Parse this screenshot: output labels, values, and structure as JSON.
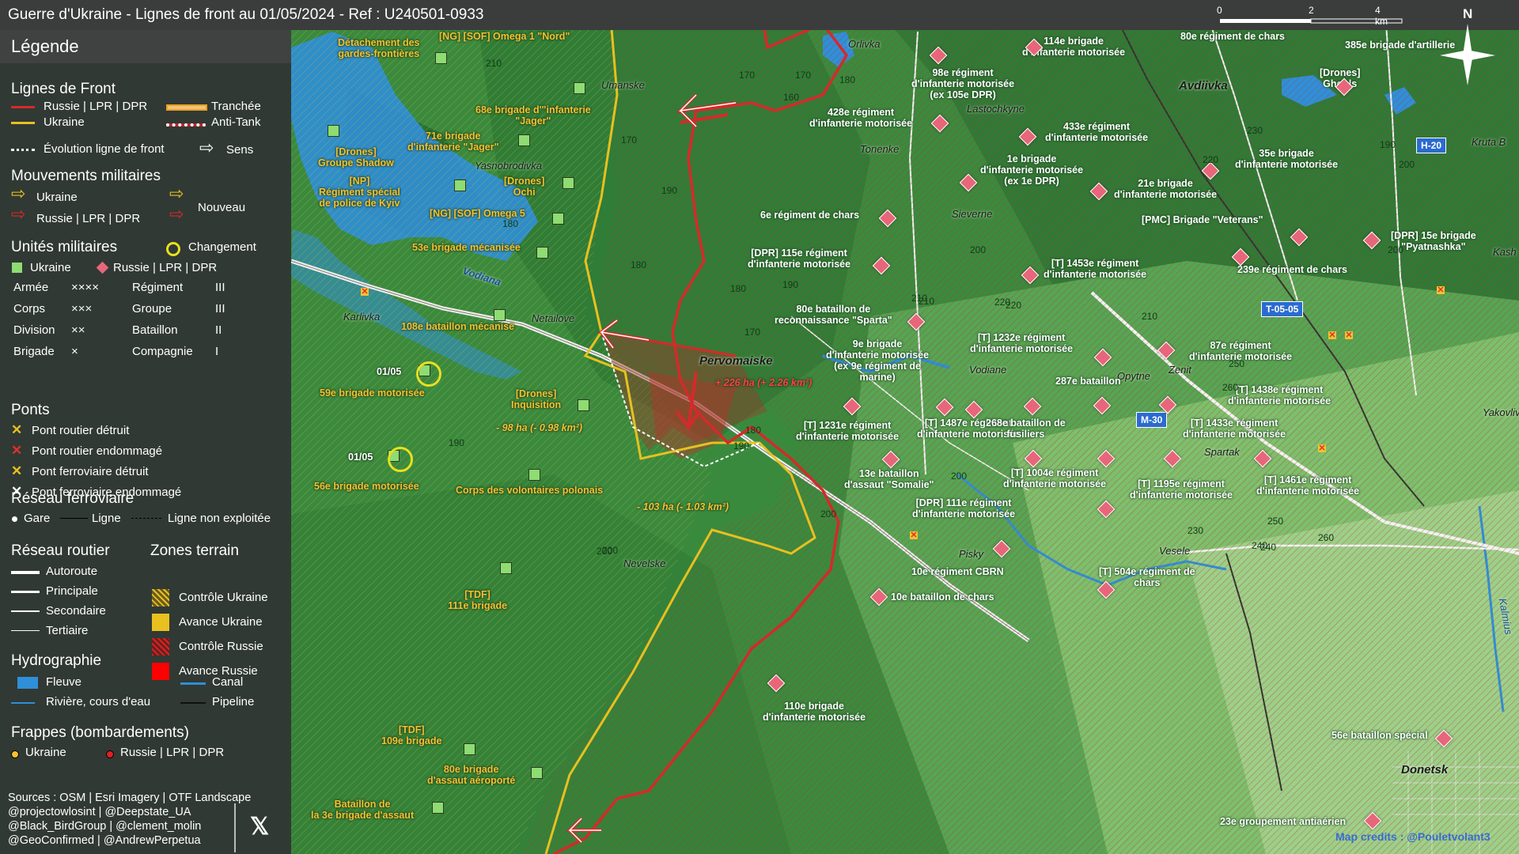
{
  "title": "Guerre d'Ukraine - Lignes de front au 01/05/2024 - Ref : U240501-0933",
  "legend": {
    "title": "Légende",
    "front_lines": {
      "heading": "Lignes de Front",
      "russia": "Russie | LPR | DPR",
      "ukraine": "Ukraine",
      "evolution": "Évolution ligne de front",
      "trench": "Tranchée",
      "antitank": "Anti-Tank",
      "direction": "Sens"
    },
    "movements": {
      "heading": "Mouvements militaires",
      "ukraine": "Ukraine",
      "russia": "Russie | LPR | DPR",
      "new": "Nouveau"
    },
    "units": {
      "heading": "Unités militaires",
      "change": "Changement",
      "ukraine": "Ukraine",
      "russia": "Russie | LPR | DPR",
      "rows": [
        {
          "a": "Armée",
          "as": "××××",
          "b": "Régiment",
          "bs": "III"
        },
        {
          "a": "Corps",
          "as": "×××",
          "b": "Groupe",
          "bs": "III"
        },
        {
          "a": "Division",
          "as": "××",
          "b": "Bataillon",
          "bs": "II"
        },
        {
          "a": "Brigade",
          "as": "×",
          "b": "Compagnie",
          "bs": "I"
        }
      ]
    },
    "bridges": {
      "heading": "Ponts",
      "items": [
        "Pont routier détruit",
        "Pont routier endommagé",
        "Pont ferroviaire détruit",
        "Pont ferroviaire endommagé"
      ],
      "colors": [
        "#e8c020",
        "#e03030",
        "#e8c020",
        "#ffffff"
      ]
    },
    "rail": {
      "heading": "Réseau ferroviaire",
      "station": "Gare",
      "line": "Ligne",
      "unused": "Ligne non exploitée"
    },
    "roads": {
      "heading": "Réseau routier",
      "items": [
        "Autoroute",
        "Principale",
        "Secondaire",
        "Tertiaire"
      ]
    },
    "zones": {
      "heading": "Zones terrain",
      "items": [
        "Contrôle Ukraine",
        "Avance Ukraine",
        "Contrôle Russie",
        "Avance Russie"
      ]
    },
    "hydro": {
      "heading": "Hydrographie",
      "river": "Fleuve",
      "canal": "Canal",
      "stream": "Rivière, cours d'eau",
      "pipeline": "Pipeline"
    },
    "strikes": {
      "heading": "Frappes (bombardements)",
      "ukraine": "Ukraine",
      "russia": "Russie | LPR | DPR"
    },
    "sources": [
      "Sources : OSM | Esri Imagery | OTF Landscape",
      "@projectowlosint | @Deepstate_UA",
      "@Black_BirdGroup | @clement_molin",
      "@GeoConfirmed | @AndrewPerpetua"
    ],
    "x_icon": "x-logo-icon"
  },
  "scale": {
    "labels": [
      "0",
      "2",
      "4 km"
    ],
    "mid": "210"
  },
  "north": "N",
  "credits": "Map credits : @Pouletvolant3",
  "colors": {
    "russia": "#d42a2a",
    "ukraine": "#e8c020",
    "ru_unit": "#e8667a",
    "ua_unit": "#8edc72",
    "water": "#2f8fd8"
  },
  "places": [
    {
      "t": "Umanske",
      "big": false
    },
    {
      "t": "Orlivka",
      "big": false
    },
    {
      "t": "Avdiivka",
      "big": true
    },
    {
      "t": "Lastochkyne",
      "big": false
    },
    {
      "t": "Tonenke",
      "big": false
    },
    {
      "t": "Yasnobrodivka",
      "big": false
    },
    {
      "t": "Sieverne",
      "big": false
    },
    {
      "t": "Karlivka",
      "big": false
    },
    {
      "t": "Netailove",
      "big": false
    },
    {
      "t": "Vodiana",
      "big": false
    },
    {
      "t": "Pervomaiske",
      "big": true
    },
    {
      "t": "Vodiane",
      "big": false
    },
    {
      "t": "Opytne",
      "big": false
    },
    {
      "t": "Zenit",
      "big": false
    },
    {
      "t": "Spartak",
      "big": false
    },
    {
      "t": "Yakovlivka",
      "big": false
    },
    {
      "t": "Nevelske",
      "big": false
    },
    {
      "t": "Pisky",
      "big": false
    },
    {
      "t": "Vesele",
      "big": false
    },
    {
      "t": "Donetsk",
      "big": true
    },
    {
      "t": "Kruta B",
      "big": false
    },
    {
      "t": "Kash",
      "big": false
    },
    {
      "t": "Kalmius",
      "big": false
    }
  ],
  "road_shields": [
    "H-20",
    "T-05-05",
    "M-30"
  ],
  "area_changes": [
    {
      "t": "+ 226 ha (+ 2.26 km²)",
      "side": "ru"
    },
    {
      "t": "- 98 ha (- 0.98 km²)",
      "side": "ua"
    },
    {
      "t": "- 103 ha (- 1.03 km²)",
      "side": "ua"
    }
  ],
  "ua_units": [
    "Détachement des\ngardes-frontières",
    "[NG] [SOF] Omega 1 \"Nord\"",
    "68e brigade d'\"infanterie\n\"Jager\"",
    "71e brigade\nd'infanterie \"Jager\"",
    "[Drones]\nGroupe Shadow",
    "[NP]\nRégiment spécial\nde police de Kyiv",
    "[Drones]\nOchi",
    "[NG] [SOF] Omega 5",
    "53e brigade mécanisée",
    "108e bataillon mécanisé",
    "59e brigade motorisée",
    "56e brigade motorisée",
    "[Drones]\nInquisition",
    "Corps des volontaires polonais",
    "[TDF]\n111e brigade",
    "[TDF]\n109e brigade",
    "80e brigade\nd'assaut aéroporté",
    "Bataillon de\nla 3e brigade d'assaut"
  ],
  "ua_dates": [
    "01/05",
    "01/05"
  ],
  "ru_units": [
    "114e brigade\nd'infanterie motorisée",
    "80e régiment de chars",
    "385e brigade d'artillerie",
    "98e régiment\nd'infanterie motorisée\n(ex 105e DPR)",
    "428e régiment\nd'infanterie motorisée",
    "433e régiment\nd'infanterie motorisée",
    "[Drones]\nGhouls",
    "1e brigade\nd'infanterie motorisée\n(ex 1e DPR)",
    "35e brigade\nd'infanterie motorisée",
    "21e brigade\nd'infanterie motorisée",
    "6e régiment de chars",
    "[PMC] Brigade \"Veterans\"",
    "[DPR] 15e brigade\n\"Pyatnashka\"",
    "[DPR] 115e régiment\nd'infanterie motorisée",
    "[T] 1453e régiment\nd'infanterie motorisée",
    "239e régiment de chars",
    "80e bataillon de\nreconnaissance \"Sparta\"",
    "9e brigade\nd'infanterie motorisée\n(ex 9e régiment de\nmarine)",
    "[T] 1232e régiment\nd'infanterie motorisée",
    "87e régiment\nd'infanterie motorisée",
    "287e bataillon",
    "[T] 1438e régiment\nd'infanterie motorisée",
    "[T] 1231e régiment\nd'infanterie motorisée",
    "[T] 1487e régiment\nd'infanterie motorisée",
    "268e bataillon de\nfusiliers",
    "[T] 1433e régiment\nd'infanterie motorisée",
    "13e bataillon\nd'assaut \"Somalie\"",
    "[T] 1004e régiment\nd'infanterie motorisée",
    "[T] 1195e régiment\nd'infanterie motorisée",
    "[T] 1461e régiment\nd'infanterie motorisée",
    "[DPR] 111e régiment\nd'infanterie motorisée",
    "10e régiment CBRN",
    "[T] 504e régiment de\nchars",
    "10e bataillon de chars",
    "110e brigade\nd'infanterie motorisée",
    "56e bataillon spécial",
    "23e groupement antiaérien"
  ],
  "altitudes": [
    "200",
    "210",
    "200",
    "170",
    "170",
    "160",
    "180",
    "170",
    "190",
    "180",
    "180",
    "190",
    "210",
    "220",
    "210",
    "200",
    "200",
    "220",
    "230",
    "190",
    "200",
    "170",
    "180",
    "190",
    "200",
    "200",
    "200",
    "250",
    "260",
    "240",
    "250",
    "260",
    "230",
    "240",
    "180",
    "190",
    "200",
    "210",
    "220"
  ]
}
